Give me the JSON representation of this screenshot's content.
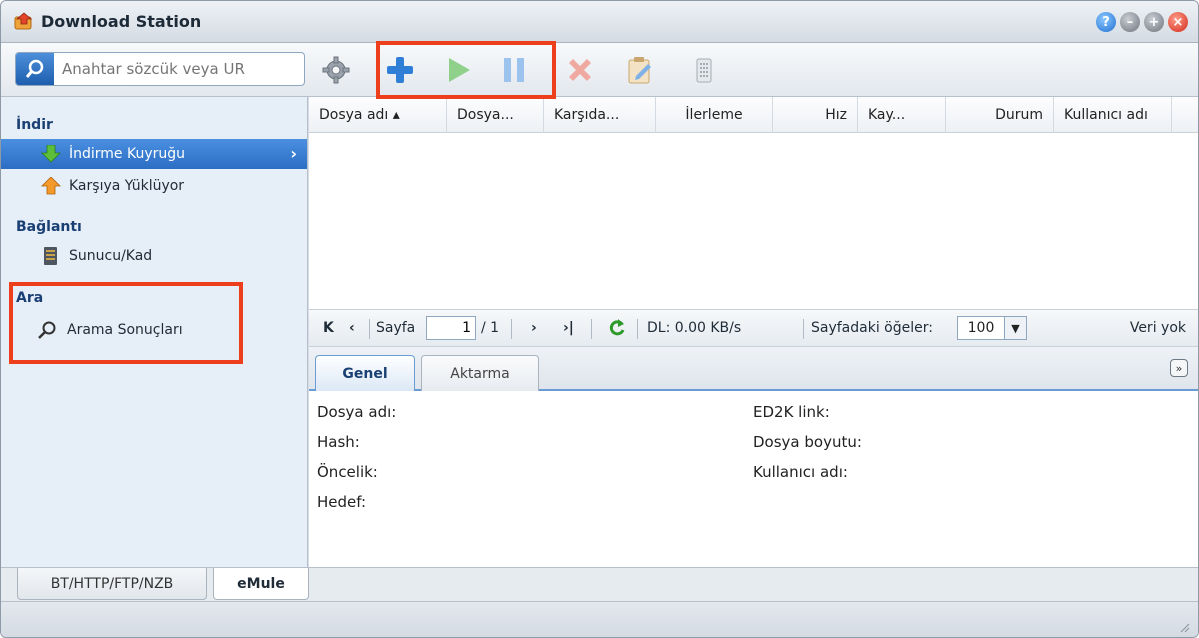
{
  "window": {
    "title": "Download Station"
  },
  "toolbar": {
    "search_placeholder": "Anahtar sözcük veya UR"
  },
  "sidebar": {
    "sections": [
      {
        "header": "İndir",
        "items": [
          "İndirme Kuyruğu",
          "Karşıya Yüklüyor"
        ]
      },
      {
        "header": "Bağlantı",
        "items": [
          "Sunucu/Kad"
        ]
      },
      {
        "header": "Ara",
        "items": [
          "Arama Sonuçları"
        ]
      }
    ],
    "selected": "İndirme Kuyruğu"
  },
  "grid": {
    "columns": [
      "Dosya adı ▴",
      "Dosya...",
      "Karşıda...",
      "İlerleme",
      "Hız",
      "Kay...",
      "Durum",
      "Kullanıcı adı"
    ]
  },
  "pager": {
    "page_label": "Sayfa",
    "page_value": "1",
    "page_total": "/ 1",
    "dl_speed": "DL: 0.00 KB/s",
    "items_per_page_label": "Sayfadaki öğeler:",
    "items_per_page": "100",
    "empty_text": "Veri yok"
  },
  "detail": {
    "tabs": [
      "Genel",
      "Aktarma"
    ],
    "active_tab": "Genel",
    "left_labels": [
      "Dosya adı:",
      "Hash:",
      "Öncelik:",
      "Hedef:"
    ],
    "right_labels": [
      "ED2K link:",
      "Dosya boyutu:",
      "Kullanıcı adı:"
    ]
  },
  "bottom_tabs": [
    "BT/HTTP/FTP/NZB",
    "eMule"
  ],
  "active_bottom_tab": "eMule",
  "colors": {
    "highlight": "#ee3f1d",
    "selection": "#2b6ec4",
    "section_header": "#1a3f73"
  }
}
